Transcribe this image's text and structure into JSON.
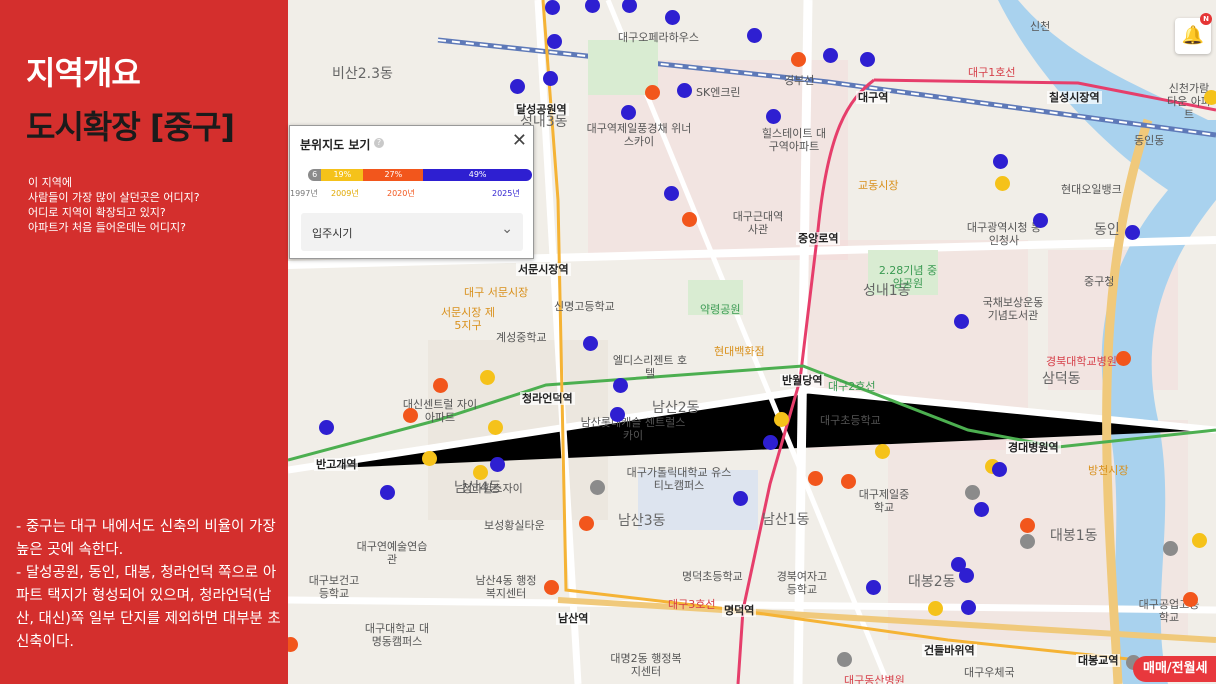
{
  "panel": {
    "title_line1": "지역개요",
    "title_line2": "도시확장 [중구]",
    "questions": [
      "이 지역에",
      "사람들이 가장 많이 살던곳은 어디지?",
      "어디로 지역이 확장되고 있지?",
      "아파트가 처음 들어온데는 어디지?"
    ],
    "summary": [
      "- 중구는 대구 내에서도 신축의 비율이 가장 높은 곳에 속한다.",
      "- 달성공원, 동인, 대봉, 청라언덕 쪽으로 아파트 택지가 형성되어 있으며, 청라언덕(남산, 대신)쪽 일부 단지를 제외하면 대부분 초신축이다."
    ]
  },
  "popup": {
    "title": "분위지도 보기",
    "help_icon": "question-circle-icon",
    "close_icon": "close-icon",
    "segments": [
      {
        "label": "6",
        "color": "#8a8a8a",
        "pct": 6
      },
      {
        "label": "19%",
        "color": "#f5c21a",
        "pct": 19
      },
      {
        "label": "27%",
        "color": "#f2561c",
        "pct": 27
      },
      {
        "label": "49%",
        "color": "#2e1fd1",
        "pct": 49
      }
    ],
    "years": [
      "1997년",
      "2009년",
      "2020년",
      "2025년"
    ],
    "year_colors": [
      "#777777",
      "#e0a800",
      "#f2561c",
      "#2e1fd1"
    ],
    "select_label": "입주시기",
    "chevron_icon": "chevron-down-icon"
  },
  "map": {
    "labels": [
      "비산2.3동",
      "달성공원역",
      "성내3동",
      "대구역",
      "칠성시장역",
      "대구오페라하우스",
      "SK엔크린",
      "대구역제일풍경채 위너스카이",
      "힐스테이트 대구역아파트",
      "교동시장",
      "대구근대역사관",
      "중앙로역",
      "서문시장역",
      "신명고등학교",
      "약령공원",
      "성내1동",
      "2.28기념 중앙공원",
      "국채보상운동 기념도서관",
      "현대백화점",
      "반월당역",
      "청라언덕역",
      "남산2동",
      "대구초등학교",
      "대구가톨릭대학교 유스티노캠퍼스",
      "남산1동",
      "남산3동",
      "경대병원역",
      "삼덕동",
      "대봉1동",
      "대봉2동",
      "명덕역",
      "건들바위역",
      "대봉교역",
      "남산역",
      "남산4동",
      "반고개역",
      "계성중학교",
      "경북대학교병원",
      "동인",
      "중구청",
      "대구광역시청 동인청사",
      "현대오일뱅크",
      "신천가람타운 아파트",
      "방천시장",
      "대구제일중학교",
      "명덕초등학교",
      "경북여자고등학교",
      "대구공업고등학교",
      "서문시장 제5지구",
      "대구연예술연습관",
      "대구보건고등학교",
      "대구대학교 대명동캠퍼스",
      "보성황실타운",
      "대신센트럴 자이아파트",
      "남산롯데캐슬 센트럴스카이",
      "청라힐스자이",
      "남산4동 행정복지센터",
      "대명2동 행정복지센터",
      "엘디스리젠트 호텔",
      "대구동산병원",
      "대구우체국",
      "동인동",
      "대구 서문시장",
      "신천",
      "대구1호선",
      "대구3호선",
      "대구2호선",
      "경부선"
    ]
  },
  "bell": {
    "icon": "bell-icon",
    "badge": "N"
  },
  "bottom_button": "매매/전월세"
}
